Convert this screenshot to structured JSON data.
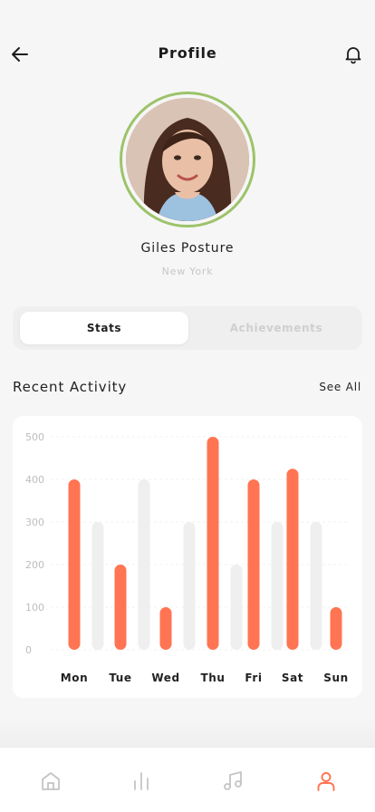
{
  "header": {
    "title": "Profile",
    "back_icon": "arrow-left-icon",
    "bell_icon": "bell-icon"
  },
  "profile": {
    "name": "Giles Posture",
    "location": "New York",
    "ring_color": "#9cc36a"
  },
  "tabs": [
    {
      "label": "Stats",
      "active": true
    },
    {
      "label": "Achievements",
      "active": false
    }
  ],
  "activity": {
    "title": "Recent Activity",
    "see_all": "See All"
  },
  "chart_data": {
    "type": "bar",
    "categories": [
      "Mon",
      "Tue",
      "Wed",
      "Thu",
      "Fri",
      "Sat",
      "Sun"
    ],
    "series": [
      {
        "values": [
          400,
          200,
          100,
          500,
          400,
          425,
          100
        ],
        "color": "#ff7452"
      },
      {
        "values": [
          300,
          400,
          300,
          200,
          300,
          300,
          null
        ],
        "color": "#efefef"
      }
    ],
    "yticks": [
      0,
      100,
      200,
      300,
      400,
      500
    ],
    "ylim": [
      0,
      500
    ],
    "grid": true
  },
  "nav": {
    "items": [
      {
        "icon": "home-icon",
        "active": false
      },
      {
        "icon": "bar-chart-icon",
        "active": false
      },
      {
        "icon": "music-icon",
        "active": false
      },
      {
        "icon": "user-icon",
        "active": true
      }
    ],
    "active_color": "#ff7452",
    "inactive_color": "#c4c4c4"
  }
}
